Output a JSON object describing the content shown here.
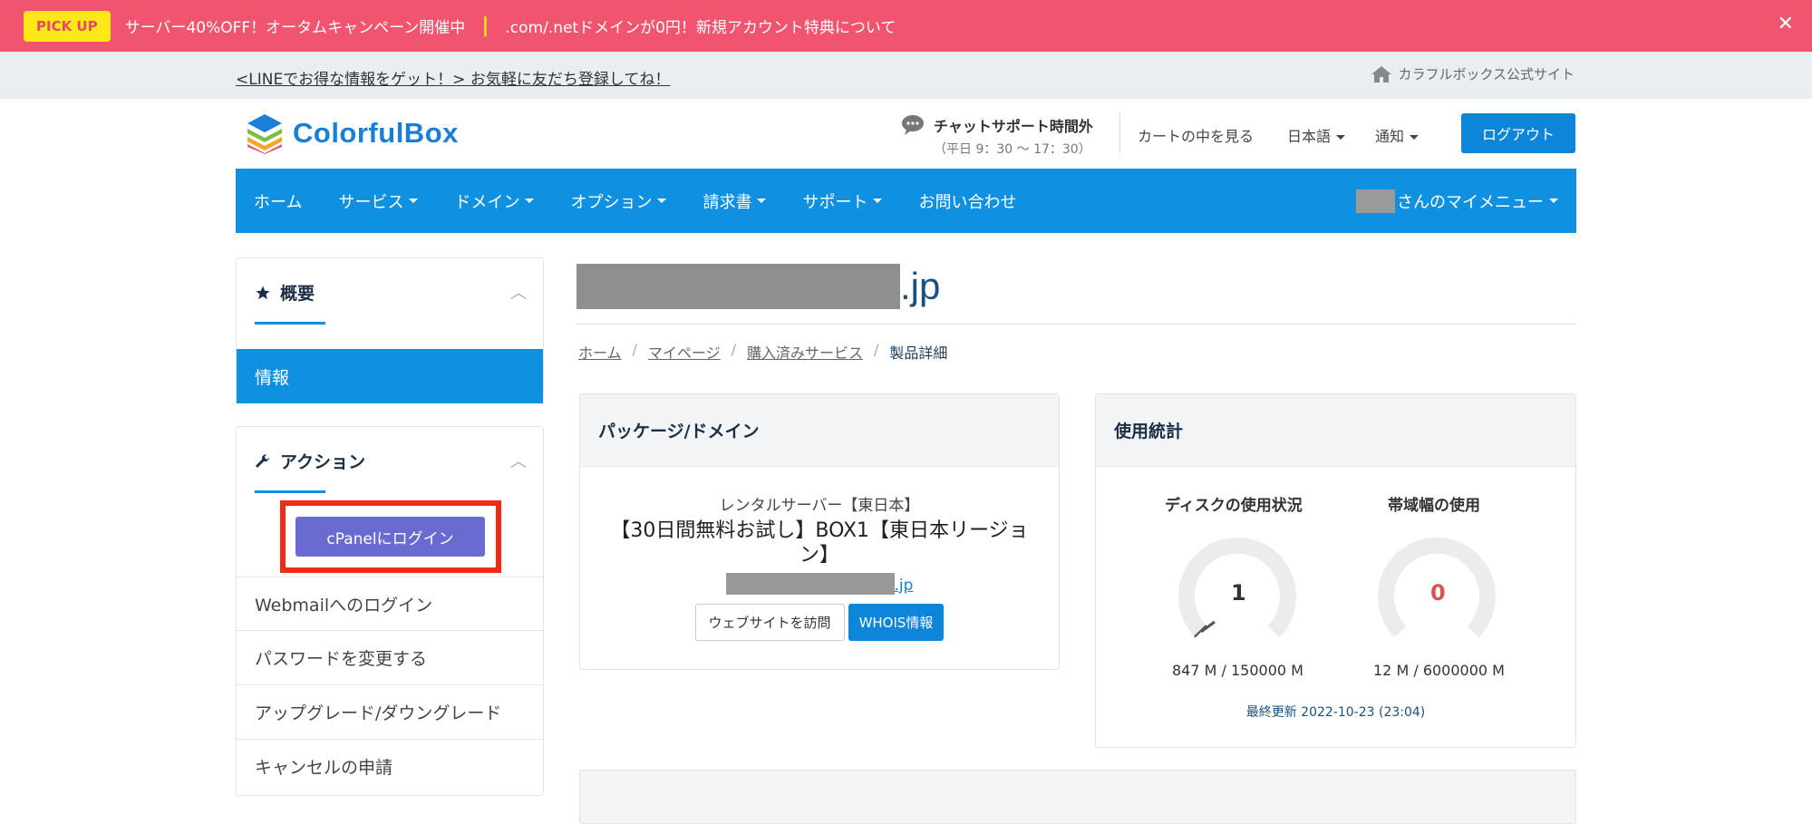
{
  "promo": {
    "badge": "PICK UP",
    "text1": "サーバー40%OFF！オータムキャンペーン開催中",
    "separator": "|",
    "text2": ".com/.netドメインが0円！新規アカウント特典について",
    "close": "✕"
  },
  "linebar": {
    "line_link": "<LINEでお得な情報をゲット！> お気軽に友だち登録してね！",
    "official_site": "カラフルボックス公式サイト"
  },
  "header": {
    "logo_text": "ColorfulBox",
    "chat_title": "チャットサポート時間外",
    "chat_hours": "（平日 9：30 〜 17：30）",
    "cart": "カートの中を見る",
    "language": "日本語",
    "notifications": "通知",
    "logout": "ログアウト"
  },
  "nav": {
    "items": [
      "ホーム",
      "サービス",
      "ドメイン",
      "オプション",
      "請求書",
      "サポート",
      "お問い合わせ"
    ],
    "my_menu": "さんのマイメニュー"
  },
  "sidebar": {
    "overview_title": "概要",
    "overview_item": "情報",
    "actions_title": "アクション",
    "cpanel_login": "cPanelにログイン",
    "actions": [
      "Webmailへのログイン",
      "パスワードを変更する",
      "アップグレード/ダウングレード",
      "キャンセルの申請"
    ]
  },
  "main": {
    "domain_suffix": ".jp",
    "breadcrumb": [
      "ホーム",
      "マイページ",
      "購入済みサービス",
      "製品詳細"
    ],
    "package": {
      "title": "パッケージ/ドメイン",
      "category": "レンタルサーバー【東日本】",
      "name": "【30日間無料お試し】BOX1【東日本リージョン】",
      "domain_suffix": ".jp",
      "visit_button": "ウェブサイトを訪問",
      "whois_button": "WHOIS情報"
    },
    "stats": {
      "title": "使用統計",
      "disk_label": "ディスクの使用状況",
      "disk_gauge": "1",
      "disk_value": "847 M / 150000 M",
      "bw_label": "帯域幅の使用",
      "bw_gauge": "0",
      "bw_value": "12 M / 6000000 M",
      "updated": "最終更新 2022-10-23 (23:04)"
    }
  },
  "colors": {
    "promo_bg": "#f0546f",
    "pickup_bg": "#ffe816",
    "primary": "#1090e0",
    "cpanel": "#6a6bd1",
    "highlight": "#f12c16",
    "gauge_zero": "#d9534f"
  }
}
